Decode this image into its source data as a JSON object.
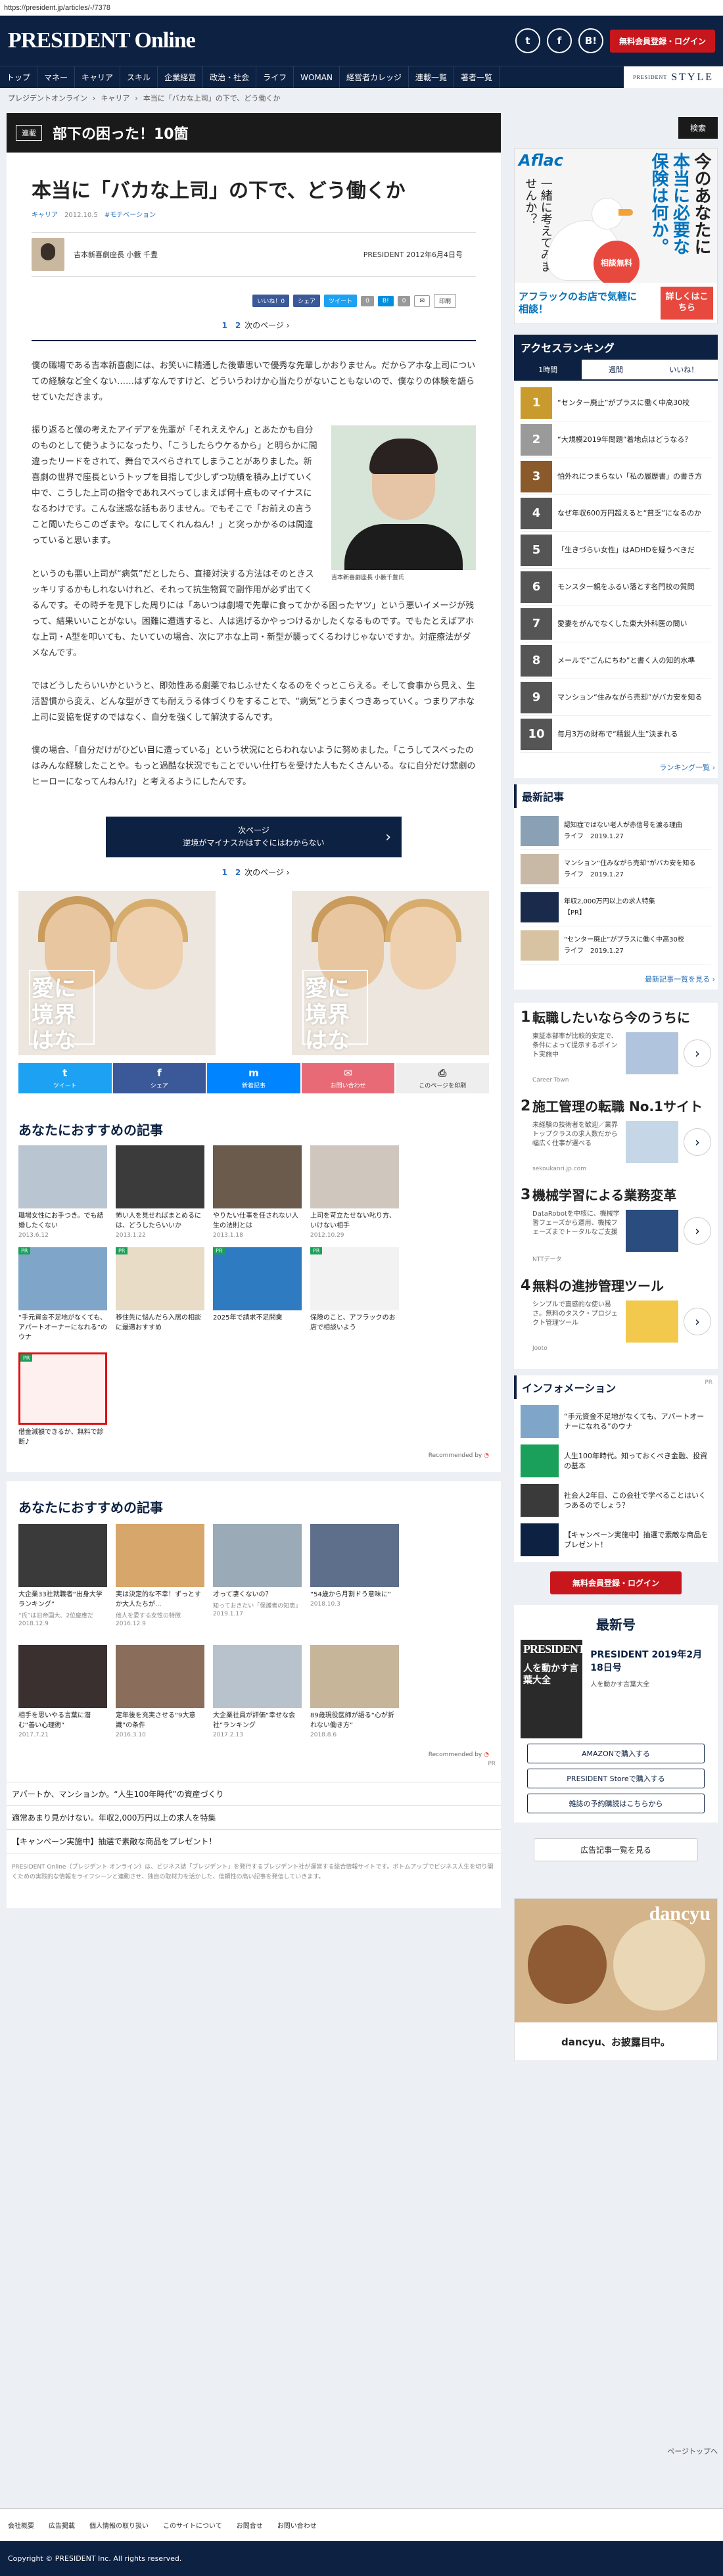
{
  "url": "https://president.jp/articles/-/7378",
  "header": {
    "logo": "PRESIDENT Online",
    "sns": [
      "t",
      "f",
      "B!"
    ],
    "login": "無料会員登録・ログイン"
  },
  "nav": {
    "items": [
      "トップ",
      "マネー",
      "キャリア",
      "スキル",
      "企業経営",
      "政治・社会",
      "ライフ",
      "WOMAN",
      "経営者カレッジ",
      "連載一覧",
      "著者一覧"
    ],
    "style_small": "PRESIDENT",
    "style": "STYLE"
  },
  "breadcrumb": [
    "プレジデントオンライン",
    "キャリア",
    "本当に「バカな上司」の下で、どう働くか"
  ],
  "serial": {
    "tag": "連載",
    "title": "部下の困った！10箇"
  },
  "article": {
    "title": "本当に「バカな上司」の下で、どう働くか",
    "category": "キャリア",
    "date": "2012.10.5",
    "tag": "#モチベーション",
    "author": "吉本新喜劇座長 小籔 千豊",
    "source": "PRESIDENT 2012年6月4日号",
    "share": [
      "いいね！0",
      "シェア",
      "ツイート",
      "0",
      "B!",
      "0",
      "✉",
      "印刷"
    ],
    "pager": {
      "p1": "1",
      "p2": "2",
      "next": "次のページ ›"
    },
    "paragraphs": [
      "僕の職場である吉本新喜劇には、お笑いに精通した後輩思いで優秀な先輩しかおりません。だからアホな上司についての経験など全くない……はずなんですけど、どういうわけか心当たりがないこともないので、僕なりの体験を語らせていただきます。",
      "振り返ると僕の考えたアイデアを先輩が「それええやん」とあたかも自分のものとして使うようになったり、「こうしたらウケるから」と明らかに間違ったリードをされて、舞台でスベらされてしまうことがありました。新喜劇の世界で座長というトップを目指して少しずつ功績を積み上げていく中で、こうした上司の指令であれスベってしまえば何十点ものマイナスになるわけです。こんな迷惑な話もありません。でもそこで「お前えの言うこと聞いたらこのざまや。なにしてくれんねん！」と突っかかるのは間違っていると思います。",
      "というのも悪い上司が“病気”だとしたら、直接対決する方法はそのときスッキリするかもしれないけれど、それって抗生物質で副作用が必ず出てくるんです。その時チを見下した周りには「あいつは劇場で先輩に食ってかかる困ったヤツ」という悪いイメージが残って、結果いいことがない。困難に遭遇すると、人は逃げるかやっつけるかしたくなるものです。でもたとえばアホな上司・A型を叩いても、たいていの場合、次にアホな上司・新型が襲ってくるわけじゃないですか。対症療法がダメなんです。",
      "ではどうしたらいいかというと、即効性ある劇薬でねじふせたくなるのをぐっとこらえる。そして食事から見え、生活習慣から変え、どんな型がきても耐えうる体づくりをすることで、“病気”とうまくつきあっていく。つまりアホな上司に妥協を促すのではなく、自分を強くして解決するんです。",
      "僕の場合、「自分だけがひどい目に遭っている」という状況にとらわれないように努めました。「こうしてスベったのはみんな経験したことや。もっと過酷な状況でもことでいい仕打ちを受けた人もたくさんいる。なに自分だけ悲劇のヒーローになってんねん!?」と考えるようにしたんです。"
    ],
    "photo_caption": "吉本新喜劇座長 小籔千豊氏",
    "next_button": {
      "label": "次ページ",
      "sub": "逆境がマイナスかはすぐにはわからない"
    },
    "ad_text": "愛に境界はない"
  },
  "sharebar": [
    {
      "label": "ツイート",
      "icon": "t",
      "color": "#1da1f2"
    },
    {
      "label": "シェア",
      "icon": "f",
      "color": "#3b5998"
    },
    {
      "label": "新着記事",
      "icon": "m",
      "color": "#0084ff"
    },
    {
      "label": "お問い合わせ",
      "icon": "✉",
      "color": "#e86a76"
    },
    {
      "label": "このページを印刷",
      "icon": "⎙",
      "color": "#eeeeee"
    }
  ],
  "recommend1": {
    "heading": "あなたにおすすめの記事",
    "by": "Recommended by",
    "items": [
      {
        "title": "職場女性にお手つき。でも結婚したくない",
        "date": "2013.6.12",
        "c": "#b9c6d2"
      },
      {
        "title": "怖い人を見せればまとめるには、どうしたらいいか",
        "date": "2013.1.22",
        "c": "#3b3b3b"
      },
      {
        "title": "やりたい仕事を任されない人生の法則とは",
        "date": "2013.1.18",
        "c": "#6b5b4d"
      },
      {
        "title": "上司を苛立たせない叱り方、いけない相手",
        "date": "2012.10.29",
        "c": "#cfc7bd"
      },
      {
        "title": "“手元資金不足地がなくても、アパートオーナーになれる”のウナ",
        "date": "",
        "c": "#7fa6c9",
        "pr": true
      },
      {
        "title": "移住先に悩んだら入居の相談に最適おすすめ",
        "date": "",
        "c": "#e8dcc6",
        "pr": true
      },
      {
        "title": "2025年で請求不足開業",
        "date": "",
        "c": "#2f7bc2",
        "pr": true
      },
      {
        "title": "保険のこと、アフラックのお店で相談いよう",
        "date": "",
        "c": "#f2f2f2",
        "pr": true
      },
      {
        "title": "借金減額できるか、無料で診断♪",
        "date": "",
        "c": "#fff0f0",
        "pr": true
      }
    ]
  },
  "recommend2": {
    "heading": "あなたにおすすめの記事",
    "by": "Recommended by",
    "items": [
      {
        "title": "大企業33社就職者“出身大学ランキング”",
        "sub": "“氏”は旧帝国大、2位慶應だ",
        "date": "2018.12.9",
        "c": "#3a3a3a"
      },
      {
        "title": "実は決定的な不幸！ずっとすか大人たちが...",
        "sub": "他人を愛する女性の特徴",
        "date": "2016.12.9",
        "c": "#d6a66b"
      },
      {
        "title": "才って凄くないの？",
        "sub": "知っておきたい「保護者の知恵」",
        "date": "2019.1.17",
        "c": "#9aaab6"
      },
      {
        "title": "“54歳から月割ドう意味に”",
        "sub": "",
        "date": "2018.10.3",
        "c": "#5d6f8a"
      },
      {
        "title": "相手を思いやる言葉に潜む“善い心理術”",
        "sub": "",
        "date": "2017.7.21",
        "c": "#3a3030"
      },
      {
        "title": "定年後を充実させる“9大意識”の条件",
        "sub": "",
        "date": "2016.3.10",
        "c": "#8a6d5a"
      },
      {
        "title": "大企業社員が評価“幸せな会社”ランキング",
        "sub": "",
        "date": "2017.2.13",
        "c": "#b8c2cc"
      },
      {
        "title": "89歳現役医師が語る“心が折れない働き方”",
        "sub": "",
        "date": "2018.8.6",
        "c": "#c7b59a"
      }
    ]
  },
  "prlinks": {
    "label": "PR",
    "items": [
      "アパートか、マンションか。“人生100年時代”の資産づくり",
      "適常あまり見かけない。年収2,000万円以上の求人を特集",
      "【キャンペーン実施中】抽選で素敵な商品をプレゼント！"
    ]
  },
  "footer_text": "PRESIDENT Online（プレジデント オンライン）は、ビジネス誌「プレジデント」を発行するプレジデント社が運営する総合情報サイトです。ボトムアップでビジネス人生を切り開くための実践的な情報をライフシーンと連動させ、独自の取材力を活かした、信頼性の高い記事を発信していきます。",
  "sidebar": {
    "search": "検索",
    "aflac": {
      "logo": "Aflac",
      "v1": "今のあなたに",
      "v2": "本当に必要な",
      "v3": "保険は何か。",
      "v4": "一緒に考えてみませんか？",
      "badge": "相談無料",
      "bottom": "アフラックのお店で気軽に相談！",
      "cta": "詳しくはこちら"
    },
    "ranking": {
      "heading": "アクセスランキング",
      "tabs": [
        "1時間",
        "週間",
        "いいね！"
      ],
      "items": [
        "“センター廃止”がプラスに働く中高30校",
        "“大規模2019年問題”着地点はどうなる？",
        "怕外れにつまらない「私の履歴書」の書き方",
        "なぜ年収600万円超えると“貧乏”になるのか",
        "「生きづらい女性」はADHDを疑うべきだ",
        "モンスター親をふるい落とす名門校の質問",
        "愛妻をがんでなくした東大外科医の問い",
        "メールで“ごんにちわ”と書く人の知的水準",
        "マンション“住みながら売却”がバカ安を知る",
        "毎月3万の財布で“精鋭人生”決まれる"
      ],
      "more": "ランキング一覧 ›"
    },
    "latest": {
      "heading": "最新記事",
      "items": [
        {
          "t": "認知症ではない老人が赤信号を渡る理由",
          "s": "ライフ　2019.1.27"
        },
        {
          "t": "マンション“住みながら売却”がバカ安を知る",
          "s": "ライフ　2019.1.27"
        },
        {
          "t": "年収2,000万円以上の求人特集",
          "s": "【PR】"
        },
        {
          "t": "“センター廃止”がプラスに働く中高30校",
          "s": "ライフ　2019.1.27"
        }
      ],
      "more": "最新記事一覧を見る ›"
    },
    "textads": [
      {
        "n": "1",
        "h": "転職したいなら今のうちに",
        "d": "東証本部率が比較的安定で、条件によって提示するポイント実施中",
        "s": "Career Town"
      },
      {
        "n": "2",
        "h": "施工管理の転職 No.1サイト",
        "d": "未経験の技術者を歓迎／業界トップクラスの求人数だから幅広く仕事が選べる",
        "s": "sekoukanri.jp.com"
      },
      {
        "n": "3",
        "h": "機械学習による業務変革",
        "d": "DataRobotを中核に、機械学習フェーズから運用、機械フェーズまでトータルなご支援",
        "s": "NTTデータ"
      },
      {
        "n": "4",
        "h": "無料の進捗管理ツール",
        "d": "シンプルで直感的な使い易さ。無料のタスク・プロジェクト管理ツール",
        "s": "Jooto"
      }
    ],
    "info": {
      "heading": "インフォメーション",
      "pr": "PR",
      "items": [
        "“手元資金不足地がなくても、アパートオーナーになれる”のウナ",
        "人生100年時代。知っておくべき金融、投資の基本",
        "社会人2年目、この会社で学べることはいくつあるのでしょう？",
        "【キャンペーン実施中】抽選で素敵な商品をプレゼント！"
      ]
    },
    "login": "無料会員登録・ログイン",
    "issue": {
      "heading": "最新号",
      "mag_title": "PRESIDENT",
      "mag_feature": "人を動かす言葉大全",
      "title": "PRESIDENT 2019年2月18日号",
      "sub": "人を動かす言葉大全",
      "buttons": [
        "AMAZONで購入する",
        "PRESIDENT Storeで購入する",
        "雑誌の予約購読はこちらから"
      ]
    },
    "adlist": "広告記事一覧を見る",
    "dancyu": {
      "logo": "dancyu",
      "text": "dancyu、お披露目中。"
    }
  },
  "pagetop": "ページトップへ",
  "footlinks": [
    "会社概要",
    "広告掲載",
    "個人情報の取り扱い",
    "このサイトについて",
    "お問合せ",
    "お問い合わせ"
  ],
  "copyright": "Copyright © PRESIDENT Inc. All rights reserved."
}
